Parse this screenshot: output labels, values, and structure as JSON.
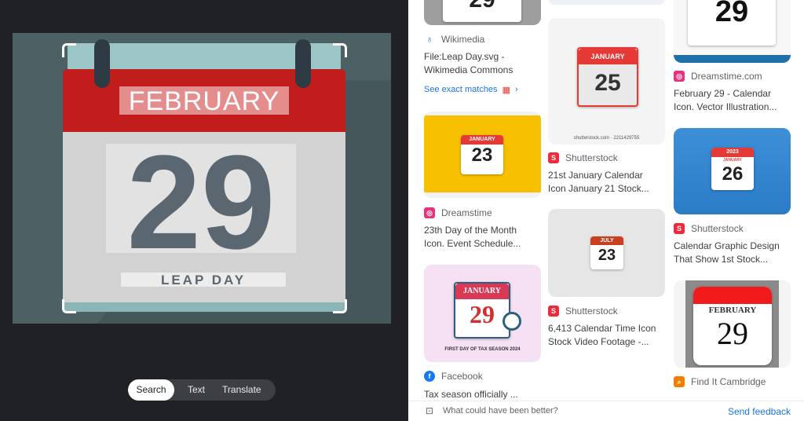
{
  "query_image": {
    "month": "FEBRUARY",
    "day": "29",
    "caption": "LEAP DAY"
  },
  "chips": [
    {
      "label": "Search",
      "selected": true
    },
    {
      "label": "Text"
    },
    {
      "label": "Translate"
    }
  ],
  "results": [
    {
      "source": "Wikimedia",
      "title1": "File:Leap Day.svg -",
      "title2": "Wikimedia Commons",
      "exact": "See exact matches",
      "thumb_day": "29"
    },
    {
      "source": "Dreamstime",
      "title1": "23th Day of the Month",
      "title2": "Icon. Event Schedule...",
      "thumb_month": "JANUARY",
      "thumb_day": "23"
    },
    {
      "source": "Facebook",
      "title1": "Tax season officially ...",
      "thumb_month": "JANUARY",
      "thumb_day": "29",
      "thumb_caption": "FIRST DAY OF TAX SEASON 2024"
    },
    {
      "source": "Shutterstock",
      "title1": "21st January Calendar",
      "title2": "Icon January 21 Stock...",
      "thumb_month": "JANUARY",
      "thumb_day": "25",
      "watermark": "shutterstock.com · 2211429755"
    },
    {
      "source": "Shutterstock",
      "title1": "6,413 Calendar Time Icon",
      "title2": "Stock Video Footage -...",
      "thumb_month": "JULY",
      "thumb_day": "23"
    },
    {
      "source": "Dreamstime.com",
      "title1": "February 29 - Calendar",
      "title2": "Icon. Vector Illustration...",
      "thumb_day": "29"
    },
    {
      "source": "Shutterstock",
      "title1": "Calendar Graphic Design",
      "title2": "That Show 1st Stock...",
      "thumb_year": "2023",
      "thumb_month": "JANUARY",
      "thumb_day": "26"
    },
    {
      "source": "Find It Cambridge",
      "thumb_month": "FEBRUARY",
      "thumb_day": "29"
    }
  ],
  "feedback": {
    "prompt": "What could have been better?",
    "link": "Send feedback"
  },
  "colors": {
    "link": "#1a73e8",
    "shutterstock": "#ee2b3b",
    "dreamstime": "#e8327c",
    "facebook": "#1877f2",
    "cambridge": "#f57c00"
  }
}
